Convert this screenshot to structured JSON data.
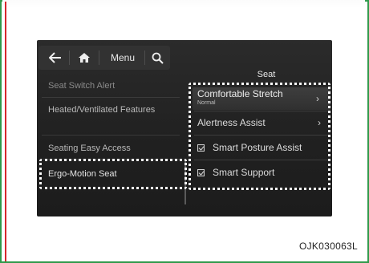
{
  "topbar": {
    "back_icon": "arrow-left-icon",
    "home_icon": "home-icon",
    "menu_label": "Menu",
    "search_icon": "search-icon"
  },
  "page": {
    "title": "Seat"
  },
  "left_menu": [
    {
      "label": "Seat Switch Alert"
    },
    {
      "label": "Heated/Ventilated Features"
    },
    {
      "label": "Seating Easy Access"
    },
    {
      "label": "Ergo-Motion Seat",
      "selected": true
    }
  ],
  "right_menu": [
    {
      "label": "Comfortable Stretch",
      "sublabel": "Normal",
      "icon": "chevron-right-icon",
      "chevron": "›"
    },
    {
      "label": "Alertness Assist",
      "icon": "chevron-right-icon",
      "chevron": "›"
    },
    {
      "label": "Smart Posture Assist",
      "checked": true
    },
    {
      "label": "Smart Support",
      "checked": true
    }
  ],
  "caption": "OJK030063L",
  "colors": {
    "frame": "#2f9a4b",
    "rule": "#d8262c",
    "screen_bg": "#222222",
    "highlight": "#ffffff"
  }
}
